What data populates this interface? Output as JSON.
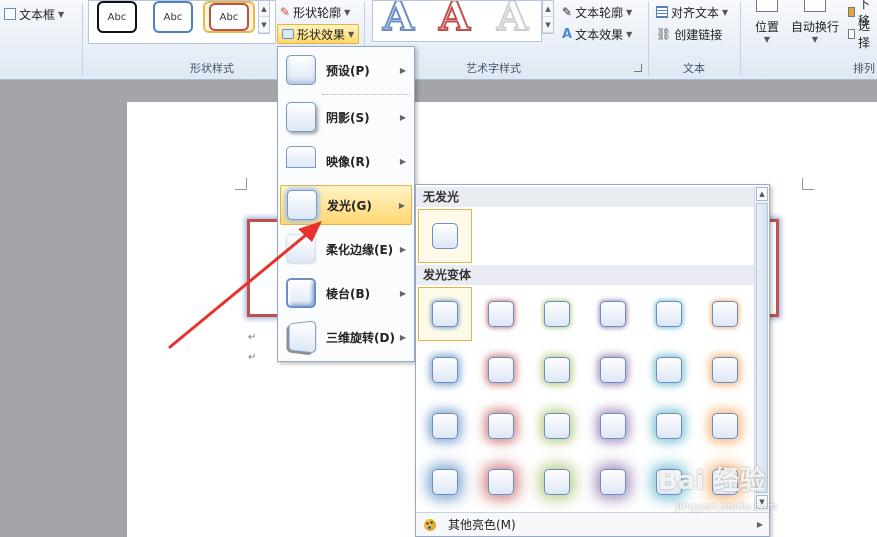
{
  "ribbon": {
    "textbox_label": "文本框",
    "shape_style_label": "形状样式",
    "wordart_style_label": "艺术字样式",
    "text_group_label": "文本",
    "arrange_label": "排列",
    "style_samples": [
      "Abc",
      "Abc",
      "Abc"
    ],
    "shape_outline": "形状轮廓",
    "shape_effects": "形状效果",
    "text_outline": "文本轮廓",
    "text_effects": "文本效果",
    "align_text": "对齐文本",
    "create_link": "创建链接",
    "position": "位置",
    "wrap_text": "自动换行",
    "bring_forward": "下移",
    "selection": "选择"
  },
  "wordart_glyphs": [
    "A",
    "A",
    "A"
  ],
  "effects_menu": {
    "items": [
      {
        "label": "预设(P)"
      },
      {
        "label": "阴影(S)"
      },
      {
        "label": "映像(R)"
      },
      {
        "label": "发光(G)"
      },
      {
        "label": "柔化边缘(E)"
      },
      {
        "label": "棱台(B)"
      },
      {
        "label": "三维旋转(D)"
      }
    ],
    "highlighted_index": 3
  },
  "glow_gallery": {
    "no_glow_header": "无发光",
    "variants_header": "发光变体",
    "footer_label": "其他亮色(M)",
    "glow_colors": [
      "#4f81bd",
      "#c0504d",
      "#9bbb59",
      "#8064a2",
      "#4bacc6",
      "#f79646"
    ],
    "glow_levels": [
      1,
      2,
      3,
      4
    ],
    "selected": {
      "row": 0,
      "col": 0
    }
  },
  "document": {
    "paragraph_mark": "↵"
  },
  "watermark": {
    "brand": "Bai 经验",
    "site": "jingyan.baidu.com"
  },
  "colors": {
    "accent_red": "#c0504d",
    "arrow_red": "#e8322e",
    "highlight": "#ffd772"
  }
}
